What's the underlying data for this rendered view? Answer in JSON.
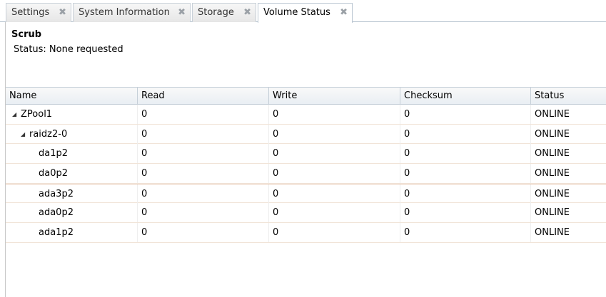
{
  "tabs": [
    {
      "label": "Settings",
      "close": "✖"
    },
    {
      "label": "System Information",
      "close": "✖"
    },
    {
      "label": "Storage",
      "close": "✖"
    },
    {
      "label": "Volume Status",
      "close": "✖"
    }
  ],
  "scrub": {
    "title": "Scrub",
    "status": "Status: None requested"
  },
  "grid": {
    "columns": [
      "Name",
      "Read",
      "Write",
      "Checksum",
      "Status"
    ],
    "rows": [
      {
        "name": "ZPool1",
        "read": "0",
        "write": "0",
        "checksum": "0",
        "status": "ONLINE",
        "expander": "◢"
      },
      {
        "name": "raidz2-0",
        "read": "0",
        "write": "0",
        "checksum": "0",
        "status": "ONLINE",
        "expander": "◢"
      },
      {
        "name": "da1p2",
        "read": "0",
        "write": "0",
        "checksum": "0",
        "status": "ONLINE"
      },
      {
        "name": "da0p2",
        "read": "0",
        "write": "0",
        "checksum": "0",
        "status": "ONLINE"
      },
      {
        "name": "ada3p2",
        "read": "0",
        "write": "0",
        "checksum": "0",
        "status": "ONLINE"
      },
      {
        "name": "ada0p2",
        "read": "0",
        "write": "0",
        "checksum": "0",
        "status": "ONLINE"
      },
      {
        "name": "ada1p2",
        "read": "0",
        "write": "0",
        "checksum": "0",
        "status": "ONLINE"
      }
    ]
  }
}
